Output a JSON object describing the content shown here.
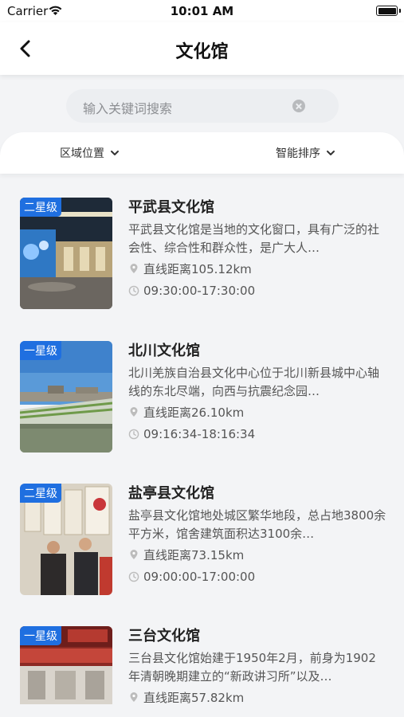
{
  "status_bar": {
    "carrier": "Carrier",
    "time": "10:01 AM"
  },
  "nav": {
    "title": "文化馆",
    "back_icon": "chevron-left-icon"
  },
  "search": {
    "placeholder": "输入关键词搜索"
  },
  "filters": {
    "region": "区域位置",
    "sort": "智能排序"
  },
  "items": [
    {
      "badge": "二星级",
      "name": "平武县文化馆",
      "desc": "平武县文化馆是当地的文化窗口，具有广泛的社会性、综合性和群众性，是广大人…",
      "distance": "直线距离105.12km",
      "hours": "09:30:00-17:30:00"
    },
    {
      "badge": "一星级",
      "name": "北川文化馆",
      "desc": "北川羌族自治县文化中心位于北川新县城中心轴线的东北尽端，向西与抗震纪念园…",
      "distance": "直线距离26.10km",
      "hours": "09:16:34-18:16:34"
    },
    {
      "badge": "二星级",
      "name": "盐亭县文化馆",
      "desc": "盐亭县文化馆地处城区繁华地段，总占地3800余平方米，馆舍建筑面积达3100余…",
      "distance": "直线距离73.15km",
      "hours": "09:00:00-17:00:00"
    },
    {
      "badge": "一星级",
      "name": "三台文化馆",
      "desc": "三台县文化馆始建于1950年2月，前身为1902年清朝晚期建立的“新政讲习所”以及…",
      "distance": "直线距离57.82km",
      "hours": ""
    }
  ]
}
